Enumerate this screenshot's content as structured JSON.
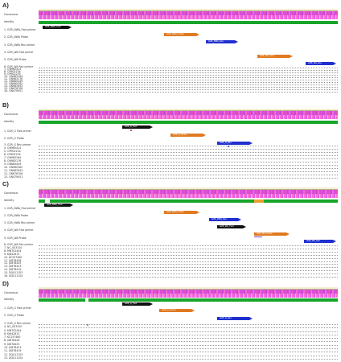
{
  "panels": [
    {
      "letter": "A)",
      "consensus": "Consensus",
      "identity": "Identity",
      "rows": [
        "1. G2R_NWA_Fwd primer",
        "2. G2R_NWA Probe",
        "3. G2R_NWA Rev primer",
        "4. G2R_WA Fwd primer",
        "5. G2R_WA Probe"
      ],
      "features": [
        {
          "name": "G2R_NWA_Fwd",
          "color": "black"
        },
        {
          "name": "G2R_NWA_Probe",
          "color": "orange"
        },
        {
          "name": "G2R_NWA_Rev",
          "color": "blue"
        },
        {
          "name": "G2R_WA_Fwd",
          "color": "orange"
        },
        {
          "name": "G2R_WA_Rev",
          "color": "blue"
        }
      ],
      "seqs": [
        "6. G2R_WA Rev primer",
        "7. ON965414",
        "8. OP902234",
        "9. OP902235",
        "10. ON983164",
        "11. ON983176",
        "12. ON880449",
        "13. ON965382",
        "14. ON983943",
        "15. ON676708",
        "16. ON479051"
      ]
    },
    {
      "letter": "B)",
      "consensus": "Consensus",
      "identity": "Identity",
      "rows": [
        "1. G2R_G Fwd primer",
        "2. G2R_G Probe"
      ],
      "features": [
        {
          "name": "G2R_G_Fwd",
          "color": "black"
        },
        {
          "name": "G2R_G_Probe",
          "color": "orange"
        },
        {
          "name": "G2R_G_Rev",
          "color": "blue"
        }
      ],
      "seqs": [
        "3. G2R_G Rev primer",
        "4. ON965414",
        "5. OP902234",
        "6. OP902235",
        "7. ON983164",
        "8. ON983176",
        "9. ON880449",
        "10. ON965382",
        "11. ON983943",
        "12. ON676708",
        "13. ON479051"
      ]
    },
    {
      "letter": "C)",
      "consensus": "Consensus",
      "identity": "Identity",
      "rows": [
        "1. G2R_NWA_Fwd primer",
        "2. G2R_NWA Probe",
        "3. G2R_NWA Rev primer",
        "4. G2R_WA Fwd primer",
        "5. G2R_WA Probe"
      ],
      "features": [
        {
          "name": "G2R_NWA_Fwd",
          "color": "black"
        },
        {
          "name": "G2R_NWA_Probe",
          "color": "orange"
        },
        {
          "name": "G2R_NWA_Rev",
          "color": "blue"
        },
        {
          "name": "G2R_WA_Fwd",
          "color": "black"
        },
        {
          "name": "G2R_WA_Probe",
          "color": "orange"
        },
        {
          "name": "G2R_WA_Rev",
          "color": "blue"
        }
      ],
      "seqs": [
        "6. G2R_WA Rev primer",
        "7. NC_003310",
        "8. MN702444",
        "9. KJ642613",
        "10. KC257460",
        "11. JX878428",
        "12. JX878425",
        "13. JX878423",
        "14. JX878419",
        "15. DQ011153",
        "16. DQ011154"
      ]
    },
    {
      "letter": "D)",
      "consensus": "Consensus",
      "identity": "Identity",
      "rows": [
        "1. G2R_G Fwd primer",
        "2. G2R_G Probe"
      ],
      "features": [
        {
          "name": "G2R_G_Fwd",
          "color": "black"
        },
        {
          "name": "G2R_G_Probe",
          "color": "orange"
        },
        {
          "name": "G2R_G_Rev",
          "color": "blue"
        }
      ],
      "seqs": [
        "3. G2R_G Rev primer",
        "4. NC_003310",
        "5. MN702444",
        "6. KJ642613",
        "7. KC257460",
        "8. JX878428",
        "9. JX878425",
        "10. JX878423",
        "11. JX878419",
        "12. DQ011153",
        "13. DQ011154"
      ]
    }
  ],
  "colors": {
    "black": "#111111",
    "orange": "#e07a20",
    "blue": "#1f2fd0",
    "identity": "#17a52a"
  }
}
